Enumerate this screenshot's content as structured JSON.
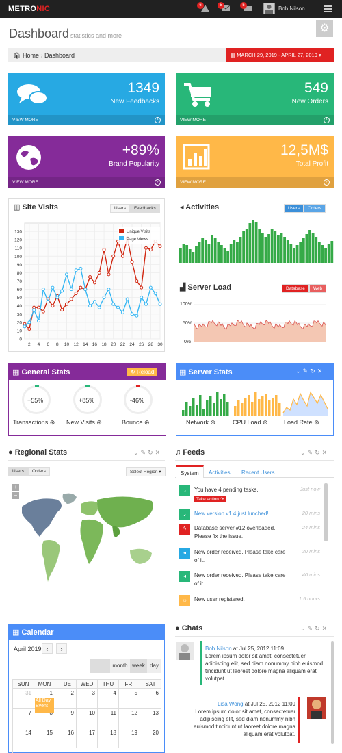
{
  "header": {
    "logo_main": "METRO",
    "logo_accent": "NIC",
    "notifications": [
      {
        "icon": "warning-icon",
        "count": "6"
      },
      {
        "icon": "envelope-icon",
        "count": "5"
      },
      {
        "icon": "tasks-icon",
        "count": "5"
      }
    ],
    "user_name": "Bob Nilson"
  },
  "page": {
    "title": "Dashboard",
    "subtitle": "statistics and more",
    "breadcrumb": {
      "home": "Home",
      "current": "Dashboard"
    },
    "date_range": "MARCH 29, 2019 - APRIL 27, 2019"
  },
  "tiles": [
    {
      "value": "1349",
      "label": "New Feedbacks",
      "more": "VIEW MORE",
      "color": "#27a9e3",
      "icon": "comments-icon"
    },
    {
      "value": "549",
      "label": "New Orders",
      "more": "VIEW MORE",
      "color": "#28b779",
      "icon": "shopping-cart-icon"
    },
    {
      "value": "+89%",
      "label": "Brand Popularity",
      "more": "VIEW MORE",
      "color": "#852b99",
      "icon": "globe-icon"
    },
    {
      "value": "12,5M$",
      "label": "Total Profit",
      "more": "VIEW MORE",
      "color": "#ffb848",
      "icon": "bar-chart-icon"
    }
  ],
  "site_visits": {
    "title": "Site Visits",
    "tabs": [
      "Users",
      "Feedbacks"
    ]
  },
  "activities": {
    "title": "Activities",
    "tabs": [
      "Users",
      "Orders"
    ]
  },
  "server_load": {
    "title": "Server Load",
    "tabs": [
      "Database",
      "Web"
    ],
    "yticks": [
      "100%",
      "50%",
      "0%"
    ]
  },
  "general_stats": {
    "title": "General Stats",
    "reload": "Reload",
    "items": [
      {
        "value": "+55%",
        "label": "Transactions",
        "color": "#28b779"
      },
      {
        "value": "+85%",
        "label": "New Visits",
        "color": "#28b779"
      },
      {
        "value": "-46%",
        "label": "Bounce",
        "color": "#e02222"
      }
    ]
  },
  "server_stats": {
    "title": "Server Stats",
    "items": [
      "Network",
      "CPU Load",
      "Load Rate"
    ]
  },
  "regional_stats": {
    "title": "Regional Stats",
    "tabs": [
      "Users",
      "Orders"
    ],
    "select": "Select Region"
  },
  "feeds": {
    "title": "Feeds",
    "tabs": [
      "System",
      "Activities",
      "Recent Users"
    ],
    "items": [
      {
        "text": "You have 4 pending tasks.",
        "tag": "Take action",
        "time": "Just now",
        "icon": "bell-icon",
        "color": "#28b779"
      },
      {
        "text": "New version v1.4 just lunched!",
        "time": "20 mins",
        "icon": "bell-icon",
        "color": "#28b779",
        "link": true
      },
      {
        "text": "Database server #12 overloaded. Please fix the issue.",
        "time": "24 mins",
        "icon": "bolt-icon",
        "color": "#e02222"
      },
      {
        "text": "New order received. Please take care of it.",
        "time": "30 mins",
        "icon": "bullhorn-icon",
        "color": "#27a9e3"
      },
      {
        "text": "New order received. Please take care of it.",
        "time": "40 mins",
        "icon": "bullhorn-icon",
        "color": "#28b779"
      },
      {
        "text": "New user registered.",
        "time": "1.5 hours",
        "icon": "sun-icon",
        "color": "#ffb848"
      }
    ]
  },
  "calendar": {
    "title": "Calendar",
    "month": "April 2019",
    "views": [
      "month",
      "week",
      "day"
    ],
    "days": [
      "SUN",
      "MON",
      "TUE",
      "WED",
      "THU",
      "FRI",
      "SAT"
    ],
    "rows": [
      [
        "31",
        "1",
        "2",
        "3",
        "4",
        "5",
        "6"
      ],
      [
        "7",
        "8",
        "9",
        "10",
        "11",
        "12",
        "13"
      ],
      [
        "14",
        "15",
        "16",
        "17",
        "18",
        "19",
        "20"
      ]
    ],
    "event": "All Day Event"
  },
  "chats": {
    "title": "Chats",
    "messages": [
      {
        "name": "Bob Nilson",
        "meta": "at Jul 25, 2012 11:09",
        "text": "Lorem ipsum dolor sit amet, consectetuer adipiscing elit, sed diam nonummy nibh euismod tincidunt ut laoreet dolore magna aliquam erat volutpat."
      },
      {
        "name": "Lisa Wong",
        "meta": "at Jul 25, 2012 11:09",
        "text": "Lorem ipsum dolor sit amet, consectetuer adipiscing elit, sed diam nonummy nibh euismod tincidunt ut laoreet dolore magna aliquam erat volutpat."
      }
    ]
  },
  "chart_data": {
    "type": "line",
    "x": [
      1,
      2,
      3,
      4,
      5,
      6,
      7,
      8,
      9,
      10,
      11,
      12,
      13,
      14,
      15,
      16,
      17,
      18,
      19,
      20,
      21,
      22,
      23,
      24,
      25,
      26,
      27,
      28,
      29,
      30
    ],
    "xticks": [
      2,
      4,
      6,
      8,
      10,
      12,
      14,
      16,
      18,
      20,
      22,
      24,
      26,
      28,
      30
    ],
    "yticks": [
      0,
      10,
      20,
      30,
      40,
      50,
      60,
      70,
      80,
      90,
      100,
      110,
      120,
      130
    ],
    "ylim": [
      0,
      140
    ],
    "xlim": [
      1,
      30
    ],
    "grid": true,
    "legend_position": "top-right",
    "series": [
      {
        "name": "Unique Visits",
        "color": "#d12610",
        "values": [
          18,
          12,
          38,
          38,
          33,
          48,
          40,
          52,
          35,
          42,
          48,
          55,
          62,
          60,
          75,
          68,
          80,
          108,
          78,
          100,
          118,
          100,
          122,
          93,
          70,
          62,
          110,
          108,
          118,
          112
        ]
      },
      {
        "name": "Page Views",
        "color": "#37b7f3",
        "values": [
          15,
          20,
          35,
          22,
          60,
          45,
          62,
          50,
          58,
          78,
          60,
          83,
          85,
          60,
          40,
          45,
          38,
          50,
          60,
          42,
          38,
          32,
          48,
          30,
          28,
          50,
          42,
          62,
          55,
          42
        ]
      }
    ]
  }
}
